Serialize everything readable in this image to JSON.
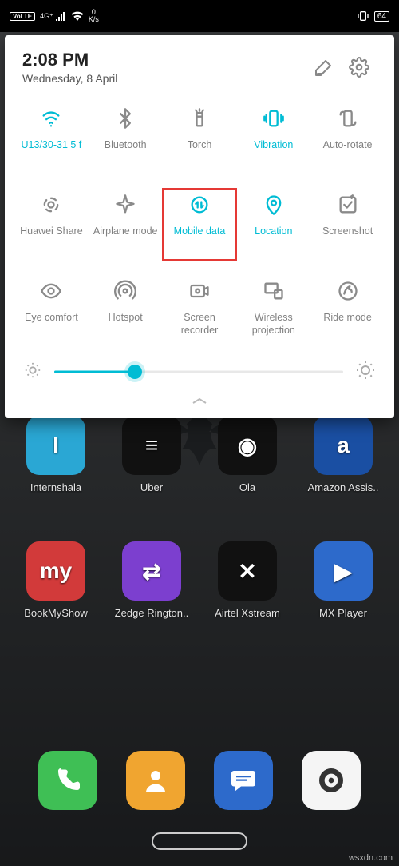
{
  "status": {
    "network_label": "VoLTE",
    "signal": "4G⁺",
    "speed_value": "0",
    "speed_unit": "K/s",
    "battery": "64"
  },
  "panel": {
    "time": "2:08 PM",
    "date": "Wednesday, 8 April",
    "brightness_percent": 28,
    "tiles": [
      {
        "id": "wifi",
        "label": "U13/30-31 5 f",
        "active": true,
        "icon": "wifi"
      },
      {
        "id": "bluetooth",
        "label": "Bluetooth",
        "active": false,
        "icon": "bluetooth"
      },
      {
        "id": "torch",
        "label": "Torch",
        "active": false,
        "icon": "torch"
      },
      {
        "id": "vibration",
        "label": "Vibration",
        "active": true,
        "icon": "vibration"
      },
      {
        "id": "autorotate",
        "label": "Auto-rotate",
        "active": false,
        "icon": "rotate"
      },
      {
        "id": "huaweishare",
        "label": "Huawei Share",
        "active": false,
        "icon": "share"
      },
      {
        "id": "airplane",
        "label": "Airplane mode",
        "active": false,
        "icon": "airplane"
      },
      {
        "id": "mobiledata",
        "label": "Mobile data",
        "active": true,
        "icon": "data",
        "highlight": true
      },
      {
        "id": "location",
        "label": "Location",
        "active": true,
        "icon": "location"
      },
      {
        "id": "screenshot",
        "label": "Screenshot",
        "active": false,
        "icon": "screenshot"
      },
      {
        "id": "eyecomfort",
        "label": "Eye comfort",
        "active": false,
        "icon": "eye"
      },
      {
        "id": "hotspot",
        "label": "Hotspot",
        "active": false,
        "icon": "hotspot"
      },
      {
        "id": "recorder",
        "label": "Screen recorder",
        "active": false,
        "icon": "recorder"
      },
      {
        "id": "projection",
        "label": "Wireless projection",
        "active": false,
        "icon": "cast"
      },
      {
        "id": "ridemode",
        "label": "Ride mode",
        "active": false,
        "icon": "ride"
      }
    ]
  },
  "home": {
    "row1": [
      {
        "label": "Internshala",
        "color": "#2aa7d4",
        "glyph": "I"
      },
      {
        "label": "Uber",
        "color": "#111111",
        "glyph": "≡"
      },
      {
        "label": "Ola",
        "color": "#111111",
        "glyph": "◉"
      },
      {
        "label": "Amazon Assis..",
        "color": "#1a4fa3",
        "glyph": "a"
      }
    ],
    "row2": [
      {
        "label": "BookMyShow",
        "color": "#d23a3a",
        "glyph": "my"
      },
      {
        "label": "Zedge Rington..",
        "color": "#7c3fcf",
        "glyph": "⇄"
      },
      {
        "label": "Airtel Xstream",
        "color": "#111111",
        "glyph": "✕"
      },
      {
        "label": "MX Player",
        "color": "#2d6acb",
        "glyph": "▶"
      }
    ],
    "dock": [
      {
        "id": "phone",
        "color": "#3fbf55",
        "glyph": "phone"
      },
      {
        "id": "contacts",
        "color": "#f0a530",
        "glyph": "contact"
      },
      {
        "id": "messages",
        "color": "#2d6acb",
        "glyph": "msg"
      },
      {
        "id": "settings",
        "color": "#f5f5f5",
        "glyph": "gear"
      }
    ]
  },
  "watermark": "wsxdn.com"
}
